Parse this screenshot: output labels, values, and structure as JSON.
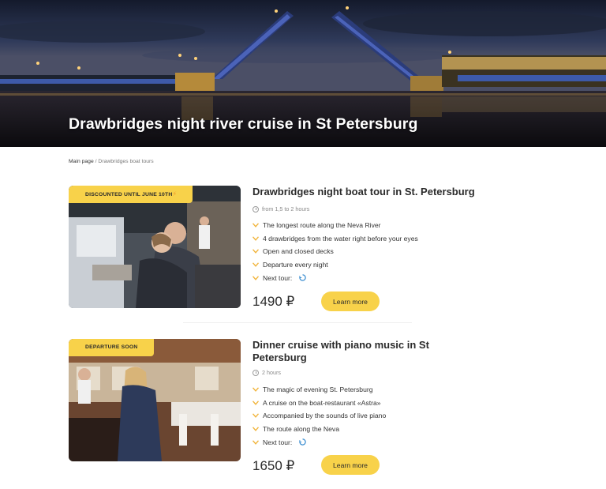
{
  "hero": {
    "title": "Drawbridges night river cruise in St Petersburg"
  },
  "breadcrumb": {
    "home": "Main page",
    "separator": " / ",
    "current": "Drawbridges boat tours"
  },
  "colors": {
    "accent": "#f8d24a",
    "check": "#f1b33a",
    "spinner": "#3d8fd1",
    "text": "#2b2b2b"
  },
  "tours": [
    {
      "badge": "DISCOUNTED UNTIL JUNE 10TH",
      "badge_icon": "flame-icon",
      "title": "Drawbridges night boat tour in St. Petersburg",
      "duration": "from 1,5 to 2 hours",
      "features": [
        "The longest route along the Neva River",
        "4 drawbridges from the water right before your eyes",
        "Open and closed decks",
        "Departure every night",
        "Next tour:"
      ],
      "price": "1490 ₽",
      "button": "Learn more"
    },
    {
      "badge": "DEPARTURE SOON",
      "title": "Dinner cruise with piano music in St Petersburg",
      "duration": "2 hours",
      "features": [
        "The magic of evening St. Petersburg",
        "A cruise on the boat-restaurant «Astra»",
        "Accompanied by the sounds of live piano",
        "The route along the Neva",
        "Next tour:"
      ],
      "price": "1650 ₽",
      "button": "Learn more"
    }
  ]
}
